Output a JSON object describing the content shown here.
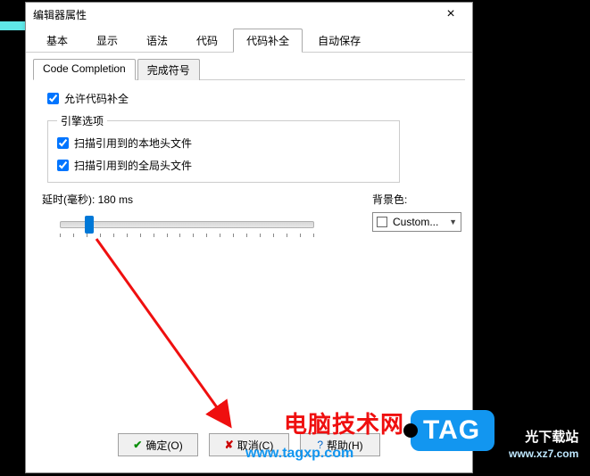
{
  "dialog": {
    "title": "编辑器属性",
    "close_icon": "×"
  },
  "tabs": [
    {
      "label": "基本"
    },
    {
      "label": "显示"
    },
    {
      "label": "语法"
    },
    {
      "label": "代码"
    },
    {
      "label": "代码补全",
      "active": true
    },
    {
      "label": "自动保存"
    }
  ],
  "subtabs": [
    {
      "label": "Code Completion",
      "active": true
    },
    {
      "label": "完成符号"
    }
  ],
  "allow_completion": {
    "label": "允许代码补全",
    "checked": true
  },
  "engine": {
    "legend": "引擎选项",
    "items": [
      {
        "label": "扫描引用到的本地头文件",
        "checked": true
      },
      {
        "label": "扫描引用到的全局头文件",
        "checked": true
      }
    ]
  },
  "delay": {
    "label_prefix": "延时(毫秒): ",
    "value_text": "180 ms"
  },
  "bgcolor": {
    "label": "背景色:",
    "selected": "Custom..."
  },
  "buttons": {
    "ok": "确定(O)",
    "cancel": "取消(C)",
    "help": "帮助(H)"
  },
  "watermarks": {
    "red_text": "电脑技术网",
    "tag_text": "TAG",
    "url": "www.tagxp.com",
    "dl_site_1": "光下载站",
    "dl_site_2": "www.xz7.com"
  }
}
